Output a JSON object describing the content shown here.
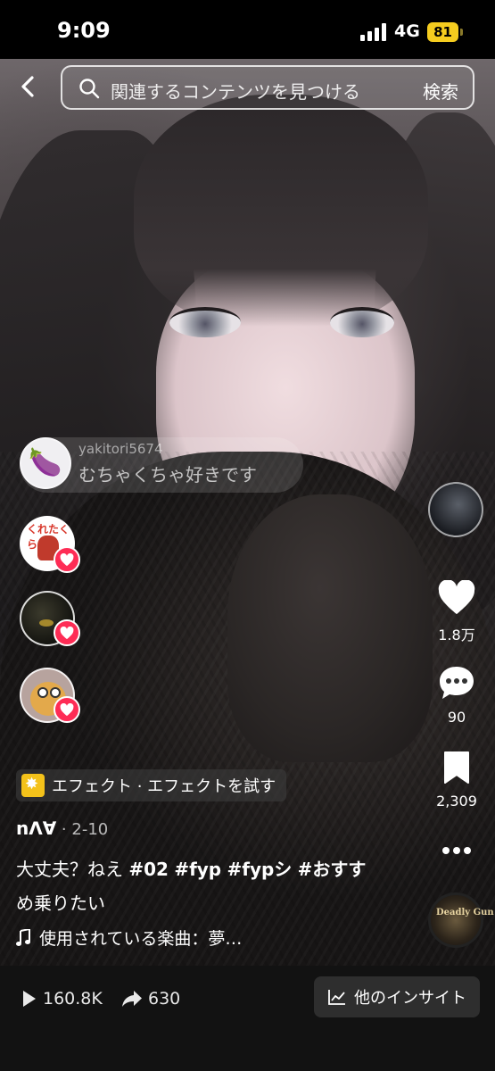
{
  "status_bar": {
    "time": "9:09",
    "network": "4G",
    "battery": "81"
  },
  "search": {
    "placeholder": "関連するコンテンツを見つける",
    "button": "検索"
  },
  "comment": {
    "username": "yakitori5674",
    "text": "むちゃくちゃ好きです",
    "avatar_emoji": "🍆"
  },
  "live_avatars": [
    {
      "label": "くれたくら"
    }
  ],
  "rail": {
    "likes": "1.8万",
    "comments": "90",
    "saves": "2,309"
  },
  "music_disc_text": "Deadly Gun",
  "effect": {
    "label": "エフェクト · エフェクトを試す"
  },
  "author": {
    "name": "nᐱ∀",
    "date": " · 2-10"
  },
  "caption": {
    "text": "大丈夫？ねえ ",
    "tags": [
      "#02",
      "#fyp",
      "#fypシ",
      "#おすす"
    ],
    "text2": "め乗りたい"
  },
  "music": {
    "label": "使用されている楽曲：夢…"
  },
  "bottom": {
    "plays": "160.8K",
    "shares": "630",
    "insight": "他のインサイト"
  },
  "colors": {
    "accent_heart": "#fe2c55",
    "battery": "#f5cc1f",
    "bottom_bar": "#121212"
  }
}
